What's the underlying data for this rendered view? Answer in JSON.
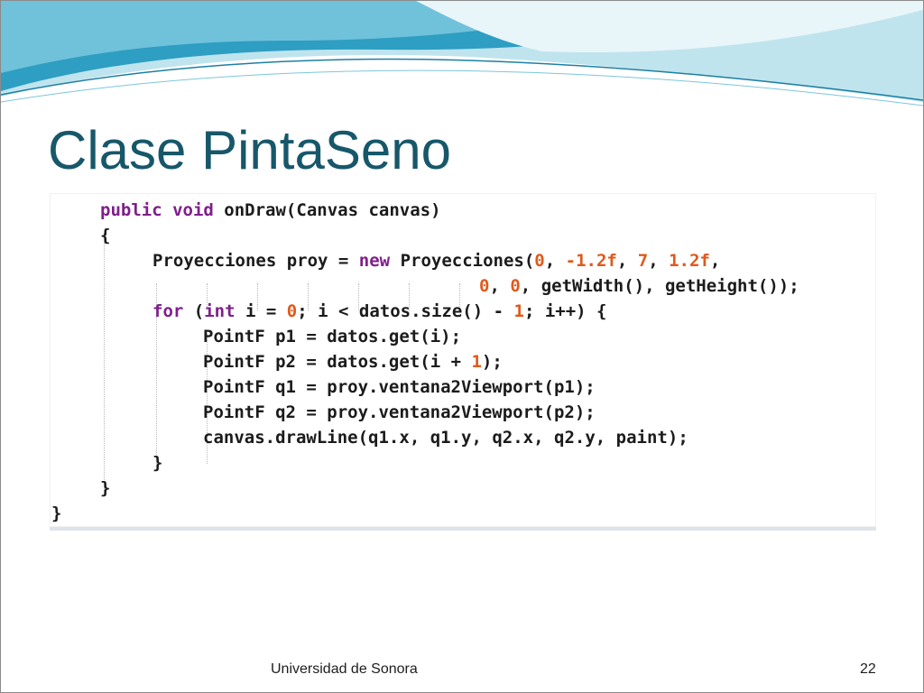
{
  "slide": {
    "title": "Clase PintaSeno",
    "footer_text": "Universidad de Sonora",
    "page_number": "22"
  },
  "code": {
    "lines": [
      [
        {
          "t": "public void ",
          "k": "kw"
        },
        {
          "t": "onDraw",
          "k": "id"
        },
        {
          "t": "(",
          "k": "pn"
        },
        {
          "t": "Canvas canvas",
          "k": "id"
        },
        {
          "t": ")",
          "k": "pn"
        }
      ],
      [
        {
          "t": "{",
          "k": "pn"
        }
      ],
      [
        {
          "t": "Proyecciones proy ",
          "k": "id"
        },
        {
          "t": "= ",
          "k": "pn"
        },
        {
          "t": "new ",
          "k": "kw"
        },
        {
          "t": "Proyecciones",
          "k": "id"
        },
        {
          "t": "(",
          "k": "pn"
        },
        {
          "t": "0",
          "k": "num"
        },
        {
          "t": ", ",
          "k": "pn"
        },
        {
          "t": "-1.2f",
          "k": "num"
        },
        {
          "t": ", ",
          "k": "pn"
        },
        {
          "t": "7",
          "k": "num"
        },
        {
          "t": ", ",
          "k": "pn"
        },
        {
          "t": "1.2f",
          "k": "num"
        },
        {
          "t": ",",
          "k": "pn"
        }
      ],
      [
        {
          "t": "0",
          "k": "num"
        },
        {
          "t": ", ",
          "k": "pn"
        },
        {
          "t": "0",
          "k": "num"
        },
        {
          "t": ", ",
          "k": "pn"
        },
        {
          "t": "getWidth",
          "k": "id"
        },
        {
          "t": "(), ",
          "k": "pn"
        },
        {
          "t": "getHeight",
          "k": "id"
        },
        {
          "t": "());",
          "k": "pn"
        }
      ],
      [
        {
          "t": "for ",
          "k": "kw"
        },
        {
          "t": "(",
          "k": "pn"
        },
        {
          "t": "int ",
          "k": "kw"
        },
        {
          "t": "i ",
          "k": "id"
        },
        {
          "t": "= ",
          "k": "pn"
        },
        {
          "t": "0",
          "k": "num"
        },
        {
          "t": "; ",
          "k": "pn"
        },
        {
          "t": "i ",
          "k": "id"
        },
        {
          "t": "< ",
          "k": "pn"
        },
        {
          "t": "datos.size",
          "k": "id"
        },
        {
          "t": "() - ",
          "k": "pn"
        },
        {
          "t": "1",
          "k": "num"
        },
        {
          "t": "; ",
          "k": "pn"
        },
        {
          "t": "i",
          "k": "id"
        },
        {
          "t": "++) {",
          "k": "pn"
        }
      ],
      [
        {
          "t": "PointF p1 ",
          "k": "id"
        },
        {
          "t": "= ",
          "k": "pn"
        },
        {
          "t": "datos.get",
          "k": "id"
        },
        {
          "t": "(",
          "k": "pn"
        },
        {
          "t": "i",
          "k": "id"
        },
        {
          "t": ");",
          "k": "pn"
        }
      ],
      [
        {
          "t": "PointF p2 ",
          "k": "id"
        },
        {
          "t": "= ",
          "k": "pn"
        },
        {
          "t": "datos.get",
          "k": "id"
        },
        {
          "t": "(",
          "k": "pn"
        },
        {
          "t": "i ",
          "k": "id"
        },
        {
          "t": "+ ",
          "k": "pn"
        },
        {
          "t": "1",
          "k": "num"
        },
        {
          "t": ");",
          "k": "pn"
        }
      ],
      [
        {
          "t": "PointF q1 ",
          "k": "id"
        },
        {
          "t": "= ",
          "k": "pn"
        },
        {
          "t": "proy.ventana2Viewport",
          "k": "id"
        },
        {
          "t": "(",
          "k": "pn"
        },
        {
          "t": "p1",
          "k": "id"
        },
        {
          "t": ");",
          "k": "pn"
        }
      ],
      [
        {
          "t": "PointF q2 ",
          "k": "id"
        },
        {
          "t": "= ",
          "k": "pn"
        },
        {
          "t": "proy.ventana2Viewport",
          "k": "id"
        },
        {
          "t": "(",
          "k": "pn"
        },
        {
          "t": "p2",
          "k": "id"
        },
        {
          "t": ");",
          "k": "pn"
        }
      ],
      [
        {
          "t": "canvas.drawLine",
          "k": "id"
        },
        {
          "t": "(",
          "k": "pn"
        },
        {
          "t": "q1.x",
          "k": "id"
        },
        {
          "t": ", ",
          "k": "pn"
        },
        {
          "t": "q1.y",
          "k": "id"
        },
        {
          "t": ", ",
          "k": "pn"
        },
        {
          "t": "q2.x",
          "k": "id"
        },
        {
          "t": ", ",
          "k": "pn"
        },
        {
          "t": "q2.y",
          "k": "id"
        },
        {
          "t": ", ",
          "k": "pn"
        },
        {
          "t": "paint",
          "k": "id"
        },
        {
          "t": ");",
          "k": "pn"
        }
      ],
      [
        {
          "t": "}",
          "k": "pn"
        }
      ],
      [
        {
          "t": "}",
          "k": "pn"
        }
      ],
      [
        {
          "t": "}",
          "k": "pn"
        }
      ]
    ]
  },
  "colors": {
    "title": "#17576a",
    "keyword": "#7f1f8a",
    "number": "#e0591b",
    "text": "#1b1b1b"
  }
}
